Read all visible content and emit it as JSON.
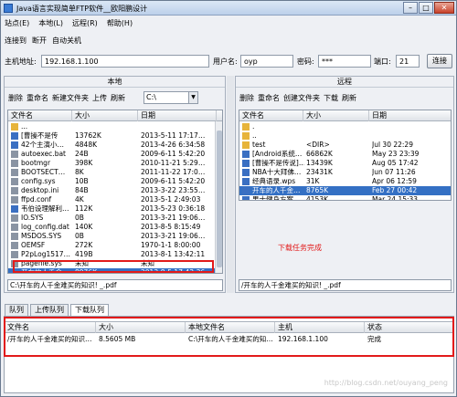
{
  "window": {
    "title": "Java语言实现简单FTP软件__欧阳鹏设计",
    "min": "–",
    "max": "□",
    "close": "✕"
  },
  "menu": [
    "站点(E)",
    "本地(L)",
    "远程(R)",
    "帮助(H)"
  ],
  "toolbar": [
    "连接到",
    "断开",
    "自动关机"
  ],
  "connection": {
    "host_label": "主机地址:",
    "host": "192.168.1.100",
    "user_label": "用户名:",
    "user": "oyp",
    "pass_label": "密码:",
    "pass": "***",
    "port_label": "端口:",
    "port": "21",
    "connect_label": "连接"
  },
  "local": {
    "title": "本地",
    "tools": [
      "删除",
      "重命名",
      "新建文件夹",
      "上传",
      "刷新"
    ],
    "drive": "C:\\",
    "columns": [
      "文件名",
      "大小",
      "日期"
    ],
    "rows": [
      {
        "name": "...",
        "size": "",
        "date": "",
        "icon": "folder"
      },
      {
        "name": "[曹操不是传",
        "size": "13762K",
        "date": "2013-5-11 17:17…",
        "icon": "doc"
      },
      {
        "name": "42个主演小…",
        "size": "4848K",
        "date": "2013-4-26 6:34:58",
        "icon": "doc"
      },
      {
        "name": "autoexec.bat",
        "size": "24B",
        "date": "2009-6-11 5:42:20",
        "icon": "file"
      },
      {
        "name": "bootmgr",
        "size": "398K",
        "date": "2010-11-21 5:29…",
        "icon": "file"
      },
      {
        "name": "BOOTSECT…",
        "size": "8K",
        "date": "2011-11-22 17:0…",
        "icon": "file"
      },
      {
        "name": "config.sys",
        "size": "10B",
        "date": "2009-6-11 5:42:20",
        "icon": "file"
      },
      {
        "name": "desktop.ini",
        "size": "84B",
        "date": "2013-3-22 23:55…",
        "icon": "file"
      },
      {
        "name": "ffpd.conf",
        "size": "4K",
        "date": "2013-5-1 2:49:03",
        "icon": "file"
      },
      {
        "name": "韦伯设理解利…",
        "size": "112K",
        "date": "2013-5-23 0:36:18",
        "icon": "doc"
      },
      {
        "name": "IO.SYS",
        "size": "0B",
        "date": "2013-3-21 19:06…",
        "icon": "file"
      },
      {
        "name": "log_config.dat",
        "size": "140K",
        "date": "2013-8-5 8:15:49",
        "icon": "file"
      },
      {
        "name": "MSDOS.SYS",
        "size": "0B",
        "date": "2013-3-21 19:06…",
        "icon": "file"
      },
      {
        "name": "OEMSF",
        "size": "272K",
        "date": "1970-1-1 8:00:00",
        "icon": "file"
      },
      {
        "name": "P2pLog1517…",
        "size": "419B",
        "date": "2013-8-1 13:42:11",
        "icon": "file"
      },
      {
        "name": "pagefile.sys",
        "size": "未知",
        "date": "未知",
        "icon": "file"
      },
      {
        "name": "开车的人千金…",
        "size": "8976K",
        "date": "2013-8-5 17:43:36",
        "icon": "doc"
      }
    ],
    "selected_index": 16,
    "path": "C:\\开车的人千金难买的知识! _.pdf"
  },
  "remote": {
    "title": "远程",
    "tools": [
      "删除",
      "重命名",
      "创建文件夹",
      "下载",
      "刷新"
    ],
    "columns": [
      "文件名",
      "大小",
      "日期"
    ],
    "rows": [
      {
        "name": ".",
        "size": "",
        "date": "",
        "icon": "folder"
      },
      {
        "name": "..",
        "size": "",
        "date": "",
        "icon": "folder"
      },
      {
        "name": "test",
        "size": "<DIR>",
        "date": "Jul 30 22:29",
        "icon": "folder"
      },
      {
        "name": "[Android系统…",
        "size": "66862K",
        "date": "May 23 23:39",
        "icon": "doc"
      },
      {
        "name": "[曹操不是传说]…",
        "size": "13439K",
        "date": "Aug 05 17:42",
        "icon": "doc"
      },
      {
        "name": "NBA十大拜佛…",
        "size": "23431K",
        "date": "Jun 07 11:26",
        "icon": "doc"
      },
      {
        "name": "经典语录.wps",
        "size": "31K",
        "date": "Apr 06 12:59",
        "icon": "doc"
      },
      {
        "name": "开车的人千金…",
        "size": "8765K",
        "date": "Feb 27 00:42",
        "icon": "doc"
      },
      {
        "name": "男士健身方案…",
        "size": "4153K",
        "date": "Mar 24 15:33",
        "icon": "doc"
      }
    ],
    "selected_index": 7,
    "status_note": "下载任务完成",
    "path": "/开车的人千金难买的知识! _.pdf"
  },
  "queue": {
    "tabs": [
      "队列",
      "上传队列",
      "下载队列"
    ],
    "active_tab": 2,
    "columns": [
      "文件名",
      "大小",
      "本地文件名",
      "主机",
      "状态"
    ],
    "rows": [
      {
        "file": "/开车的人千金难买的知识…",
        "size": "8.5605 MB",
        "local": "C:\\开车的人千金难买的知…",
        "host": "192.168.1.100",
        "status": "完成"
      }
    ]
  },
  "watermark": "http://blog.csdn.net/ouyang_peng",
  "colors": {
    "accent": "#3470c4",
    "annotation": "#e21a1a",
    "folder": "#e7b43a",
    "doc": "#3a6fc2"
  }
}
